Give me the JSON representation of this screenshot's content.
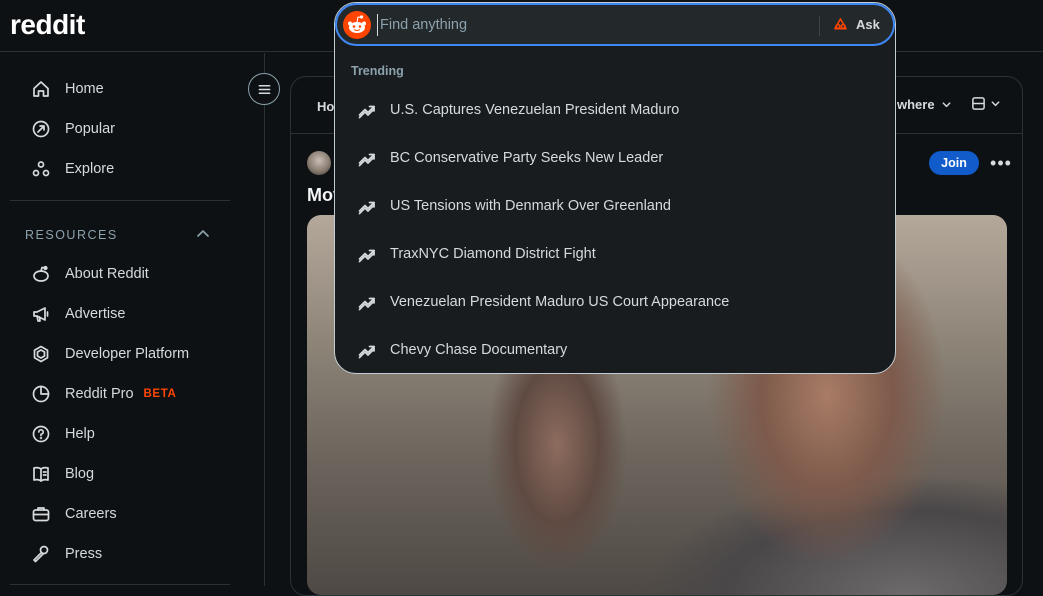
{
  "brand": {
    "logo_text": "reddit",
    "accent": "#ff4500",
    "link_blue": "#115bca"
  },
  "search": {
    "placeholder": "Find anything",
    "value": "",
    "ask_label": "Ask",
    "trending_label": "Trending",
    "trending": [
      {
        "label": "U.S. Captures Venezuelan President Maduro",
        "icon": "trending-icon"
      },
      {
        "label": "BC Conservative Party Seeks New Leader",
        "icon": "trending-icon"
      },
      {
        "label": "US Tensions with Denmark Over Greenland",
        "icon": "trending-icon"
      },
      {
        "label": "TraxNYC Diamond District Fight",
        "icon": "trending-icon"
      },
      {
        "label": "Venezuelan President Maduro US Court Appearance",
        "icon": "trending-icon"
      },
      {
        "label": "Chevy Chase Documentary",
        "icon": "trending-icon"
      }
    ]
  },
  "sidebar": {
    "main": [
      {
        "label": "Home",
        "icon": "home-icon"
      },
      {
        "label": "Popular",
        "icon": "popular-icon"
      },
      {
        "label": "Explore",
        "icon": "explore-icon"
      }
    ],
    "resources_label": "RESOURCES",
    "resources": [
      {
        "label": "About Reddit",
        "icon": "about-icon"
      },
      {
        "label": "Advertise",
        "icon": "megaphone-icon"
      },
      {
        "label": "Developer Platform",
        "icon": "developer-icon"
      },
      {
        "label": "Reddit Pro",
        "icon": "pro-icon",
        "badge": "BETA"
      },
      {
        "label": "Help",
        "icon": "help-icon"
      },
      {
        "label": "Blog",
        "icon": "blog-icon"
      },
      {
        "label": "Careers",
        "icon": "careers-icon"
      },
      {
        "label": "Press",
        "icon": "press-icon"
      }
    ]
  },
  "feed": {
    "tab_partial": "Ho",
    "sort_partial": "where",
    "post": {
      "title_partial": "Mov",
      "join_label": "Join",
      "more_label": "•••"
    }
  }
}
